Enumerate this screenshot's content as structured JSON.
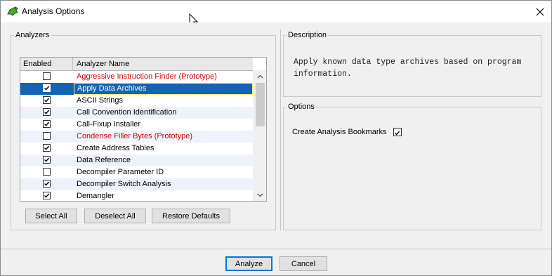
{
  "window": {
    "title": "Analysis Options",
    "icon": "dragon-app-icon",
    "close_icon": "close-icon"
  },
  "analyzers": {
    "group_label": "Analyzers",
    "columns": [
      "Enabled",
      "Analyzer Name"
    ],
    "rows": [
      {
        "enabled": false,
        "name": "Aggressive Instruction Finder (Prototype)",
        "prototype": true,
        "selected": false
      },
      {
        "enabled": true,
        "name": "Apply Data Archives",
        "prototype": false,
        "selected": true
      },
      {
        "enabled": true,
        "name": "ASCII Strings",
        "prototype": false,
        "selected": false
      },
      {
        "enabled": true,
        "name": "Call Convention Identification",
        "prototype": false,
        "selected": false
      },
      {
        "enabled": true,
        "name": "Call-Fixup Installer",
        "prototype": false,
        "selected": false
      },
      {
        "enabled": false,
        "name": "Condense Filler Bytes (Prototype)",
        "prototype": true,
        "selected": false
      },
      {
        "enabled": true,
        "name": "Create Address Tables",
        "prototype": false,
        "selected": false
      },
      {
        "enabled": true,
        "name": "Data Reference",
        "prototype": false,
        "selected": false
      },
      {
        "enabled": false,
        "name": "Decompiler Parameter ID",
        "prototype": false,
        "selected": false
      },
      {
        "enabled": true,
        "name": "Decompiler Switch Analysis",
        "prototype": false,
        "selected": false
      },
      {
        "enabled": true,
        "name": "Demangler",
        "prototype": false,
        "selected": false
      }
    ],
    "buttons": {
      "select_all": "Select All",
      "deselect_all": "Deselect All",
      "restore_defaults": "Restore Defaults"
    }
  },
  "description": {
    "group_label": "Description",
    "text": "Apply known data type archives based on program\ninformation."
  },
  "options": {
    "group_label": "Options",
    "create_bookmarks_label": "Create Analysis Bookmarks",
    "create_bookmarks_checked": true
  },
  "footer": {
    "analyze": "Analyze",
    "cancel": "Cancel"
  },
  "colors": {
    "selection": "#1464b4",
    "prototype_text": "#d40000",
    "default_button_border": "#0078d7"
  }
}
